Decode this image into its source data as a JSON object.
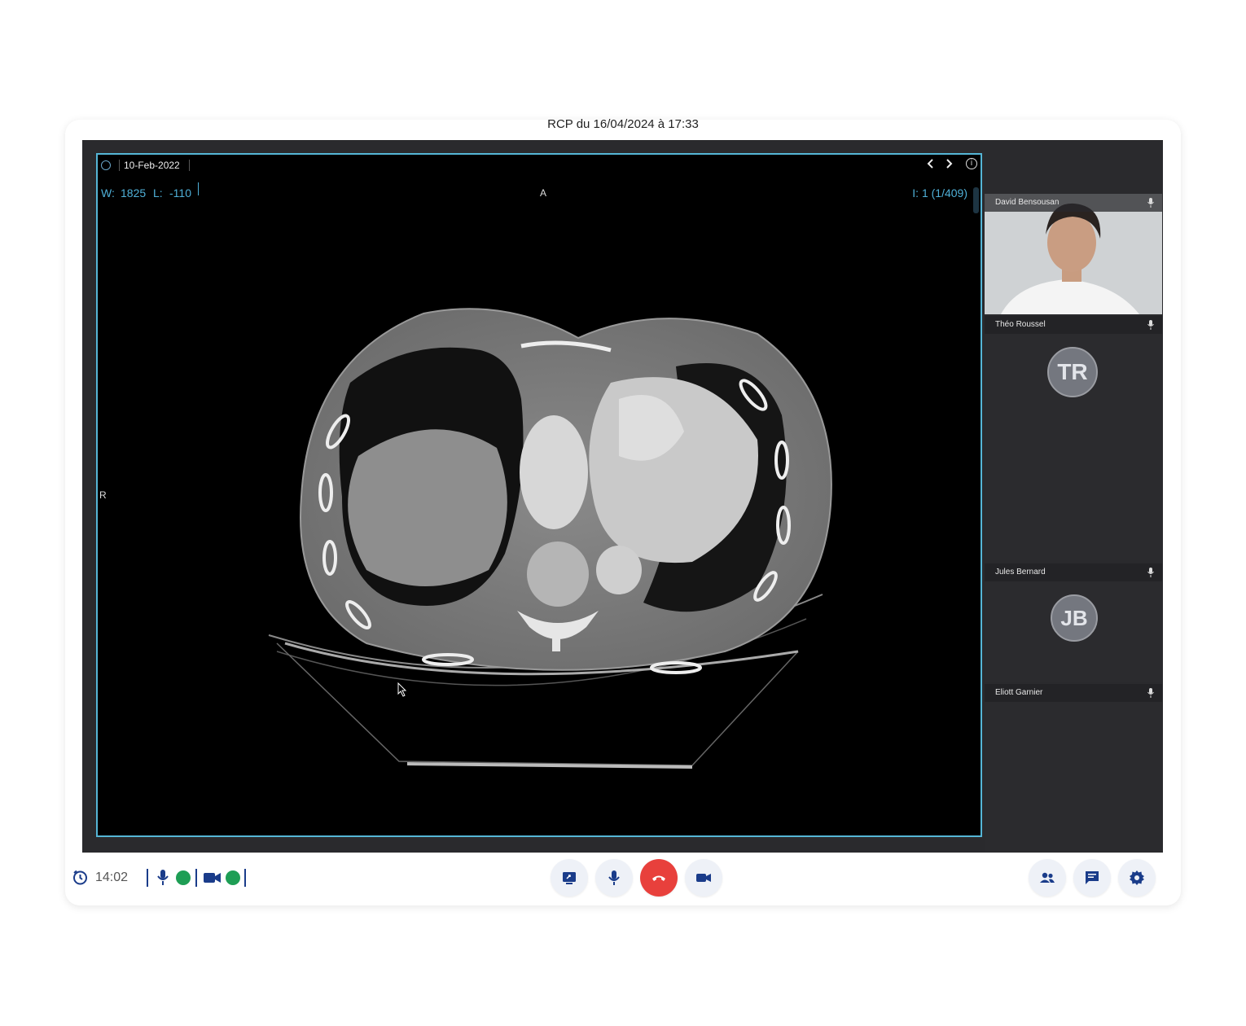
{
  "meeting": {
    "title": "RCP du 16/04/2024 à 17:33"
  },
  "viewer": {
    "study_date": "10-Feb-2022",
    "window_label": "W:",
    "window_value": "1825",
    "level_label": "L:",
    "level_value": "-110",
    "orientation_top": "A",
    "orientation_left": "R",
    "image_index": "I: 1 (1/409)",
    "accent_color": "#55b6d6"
  },
  "participants": [
    {
      "name": "David Bensousan",
      "initials": "",
      "has_video": true
    },
    {
      "name": "Théo Roussel",
      "initials": "TR",
      "has_video": false
    },
    {
      "name": "Jules Bernard",
      "initials": "JB",
      "has_video": false
    },
    {
      "name": "Eliott Garnier",
      "initials": "",
      "has_video": false
    }
  ],
  "toolbar": {
    "elapsed_time": "14:02",
    "mic_status_color": "#1e9e55",
    "camera_status_color": "#1e9e55",
    "hangup_color": "#e8403c",
    "center_controls": [
      "screen-share",
      "microphone",
      "hang-up",
      "camera"
    ],
    "right_controls": [
      "participants",
      "chat",
      "settings"
    ]
  }
}
